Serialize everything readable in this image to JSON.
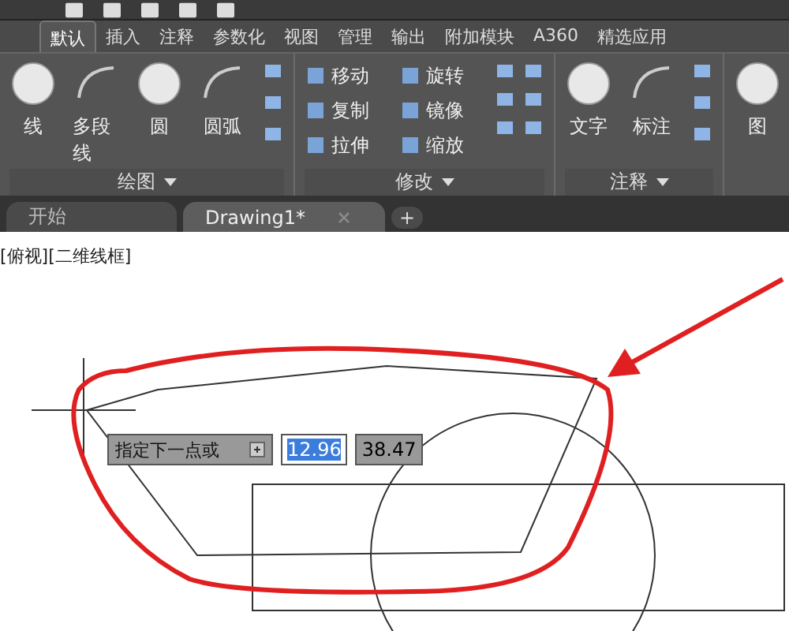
{
  "ribbon_tabs": [
    {
      "label": "默认",
      "selected": true
    },
    {
      "label": "插入",
      "selected": false
    },
    {
      "label": "注释",
      "selected": false
    },
    {
      "label": "参数化",
      "selected": false
    },
    {
      "label": "视图",
      "selected": false
    },
    {
      "label": "管理",
      "selected": false
    },
    {
      "label": "输出",
      "selected": false
    },
    {
      "label": "附加模块",
      "selected": false
    },
    {
      "label": "A360",
      "selected": false
    },
    {
      "label": "精选应用",
      "selected": false
    }
  ],
  "panels": [
    {
      "title": "绘图",
      "tools": [
        {
          "kind": "large",
          "label": "线"
        },
        {
          "kind": "large",
          "label": "多段线"
        },
        {
          "kind": "large",
          "label": "圆"
        },
        {
          "kind": "large",
          "label": "圆弧"
        },
        {
          "kind": "icons"
        }
      ]
    },
    {
      "title": "修改",
      "tools": [
        {
          "kind": "small",
          "label": "移动"
        },
        {
          "kind": "small",
          "label": "复制"
        },
        {
          "kind": "small",
          "label": "拉伸"
        },
        {
          "kind": "small",
          "label": "旋转"
        },
        {
          "kind": "small",
          "label": "镜像"
        },
        {
          "kind": "small",
          "label": "缩放"
        },
        {
          "kind": "icons"
        },
        {
          "kind": "icons"
        }
      ]
    },
    {
      "title": "注释",
      "tools": [
        {
          "kind": "large",
          "label": "文字"
        },
        {
          "kind": "large",
          "label": "标注"
        },
        {
          "kind": "icons"
        }
      ]
    },
    {
      "tools": [
        {
          "kind": "large",
          "label": "图"
        }
      ]
    }
  ],
  "file_tabs": [
    {
      "label": "开始",
      "selected": false
    },
    {
      "label": "Drawing1*",
      "selected": true,
      "closable": true
    }
  ],
  "new_tab_symbol": "+",
  "viewport_label": "[俯视][二维线框]",
  "dynamic_input": {
    "prompt": "指定下一点或",
    "fields": [
      {
        "value": "12.96",
        "selected": true
      },
      {
        "value": "38.47",
        "selected": false
      }
    ]
  }
}
